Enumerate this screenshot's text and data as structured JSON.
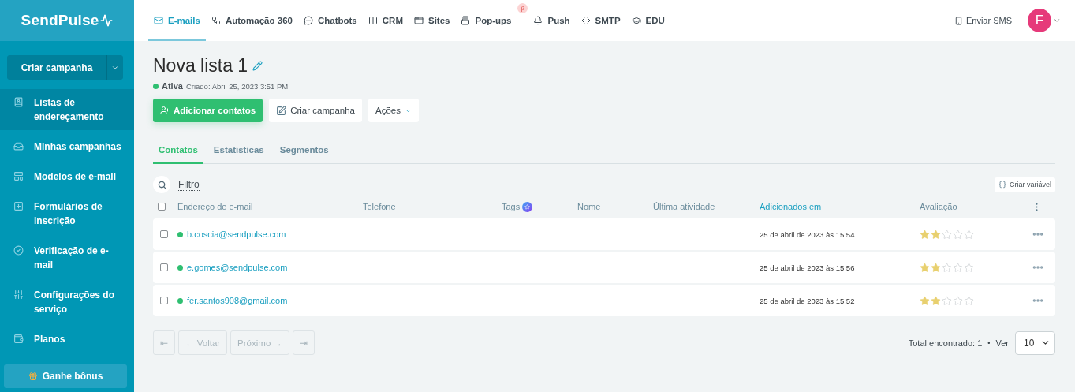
{
  "logo": {
    "text": "SendPulse"
  },
  "sidebar": {
    "create_button": "Criar campanha",
    "items": [
      {
        "label": "Listas de endereçamento",
        "selected": true
      },
      {
        "label": "Minhas campanhas",
        "selected": false
      },
      {
        "label": "Modelos de e-mail",
        "selected": false
      },
      {
        "label": "Formulários de inscrição",
        "selected": false
      },
      {
        "label": "Verificação de e-mail",
        "selected": false
      },
      {
        "label": "Configurações do serviço",
        "selected": false
      },
      {
        "label": "Planos",
        "selected": false
      }
    ],
    "bonus_button": "Ganhe bônus"
  },
  "top_nav": {
    "items": [
      {
        "label": "E-mails",
        "selected": true
      },
      {
        "label": "Automação 360",
        "selected": false
      },
      {
        "label": "Chatbots",
        "selected": false
      },
      {
        "label": "CRM",
        "selected": false
      },
      {
        "label": "Sites",
        "selected": false
      },
      {
        "label": "Pop-ups",
        "selected": false,
        "badge": "β"
      },
      {
        "label": "Push",
        "selected": false
      },
      {
        "label": "SMTP",
        "selected": false
      },
      {
        "label": "EDU",
        "selected": false
      }
    ],
    "sms_link": "Enviar SMS",
    "avatar": "F"
  },
  "page": {
    "title": "Nova lista 1",
    "status": "Ativa",
    "created": "Criado: Abril 25, 2023 3:51 PM",
    "actions": [
      "Adicionar contatos",
      "Criar campanha",
      "Ações"
    ],
    "tabs": [
      {
        "label": "Contatos",
        "selected": true
      },
      {
        "label": "Estatísticas",
        "selected": false
      },
      {
        "label": "Segmentos",
        "selected": false
      }
    ]
  },
  "filter": {
    "label": "Filtro",
    "create_variable": "Criar variável"
  },
  "table": {
    "all_checked": false,
    "columns": [
      {
        "label": "Endereço de e-mail",
        "active": false
      },
      {
        "label": "Telefone",
        "active": false
      },
      {
        "label": "Tags",
        "active": false
      },
      {
        "label": "Nome",
        "active": false
      },
      {
        "label": "Última atividade",
        "active": false
      },
      {
        "label": "Adicionados em",
        "active": true
      },
      {
        "label": "Avaliação",
        "active": false
      }
    ],
    "rows": [
      {
        "checked": false,
        "active": true,
        "email": "b.coscia@sendpulse.com",
        "added": "25 de abril de 2023 às 15:54",
        "stars": 2
      },
      {
        "checked": false,
        "active": true,
        "email": "e.gomes@sendpulse.com",
        "added": "25 de abril de 2023 às 15:56",
        "stars": 2
      },
      {
        "checked": false,
        "active": true,
        "email": "fer.santos908@gmail.com",
        "added": "25 de abril de 2023 às 15:52",
        "stars": 2
      }
    ]
  },
  "pagination": {
    "buttons": [
      {
        "label": "⇤",
        "disabled": true
      },
      {
        "label": "← Voltar",
        "disabled": true
      },
      {
        "label": "Próximo →",
        "disabled": true
      },
      {
        "label": "⇥",
        "disabled": true
      }
    ],
    "total": "Total encontrado: 1",
    "separator": "•",
    "per_page_label": "Ver",
    "per_page": "10"
  }
}
